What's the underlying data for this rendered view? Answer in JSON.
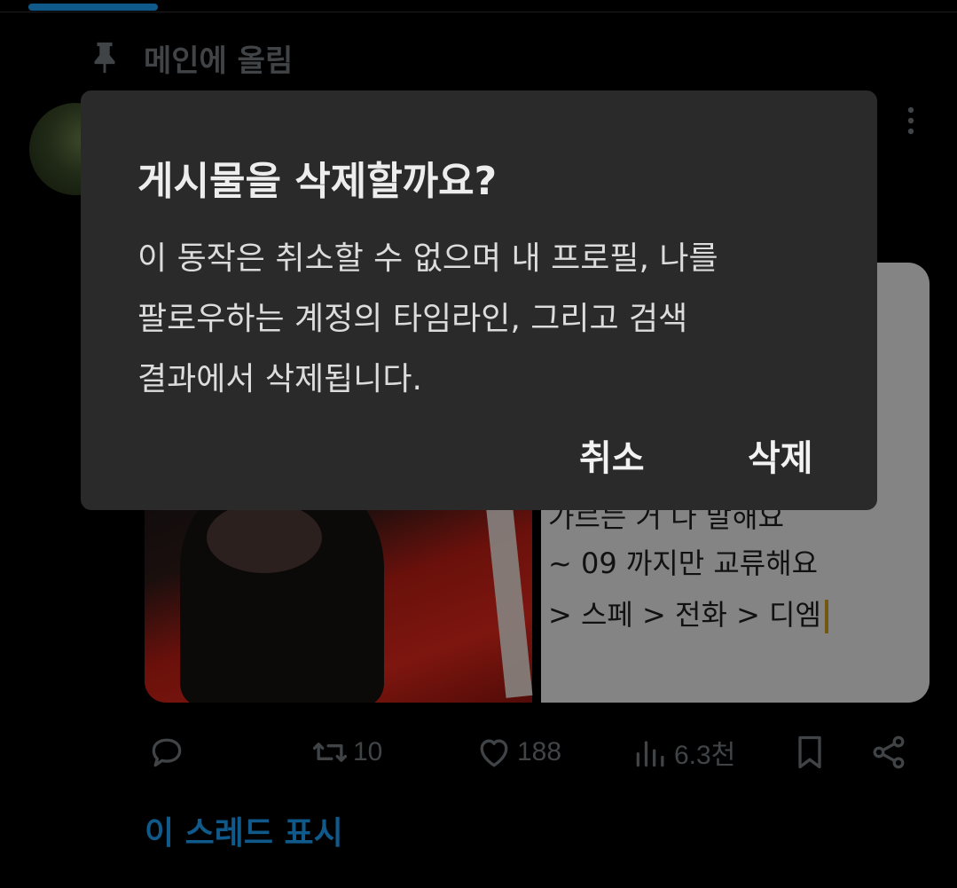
{
  "pinned": {
    "label": "메인에 올림"
  },
  "media": {
    "note_lines": [
      "가르는 거 다 말해요",
      "~ 09 까지만 교류해요",
      "> 스페 > 전화 > 디엠"
    ]
  },
  "actions": {
    "retweet_count": "10",
    "like_count": "188",
    "view_count": "6.3천"
  },
  "show_thread_label": "이 스레드 표시",
  "dialog": {
    "title": "게시물을 삭제할까요?",
    "body_lines": [
      "이 동작은 취소할 수 없으며 내 프로필, 나를",
      "팔로우하는 계정의 타임라인, 그리고 검색",
      "결과에서 삭제됩니다."
    ],
    "cancel_label": "취소",
    "delete_label": "삭제"
  },
  "colors": {
    "accent": "#1d9bf0",
    "muted": "#71767b",
    "dialog_bg": "#2a2a2a"
  }
}
